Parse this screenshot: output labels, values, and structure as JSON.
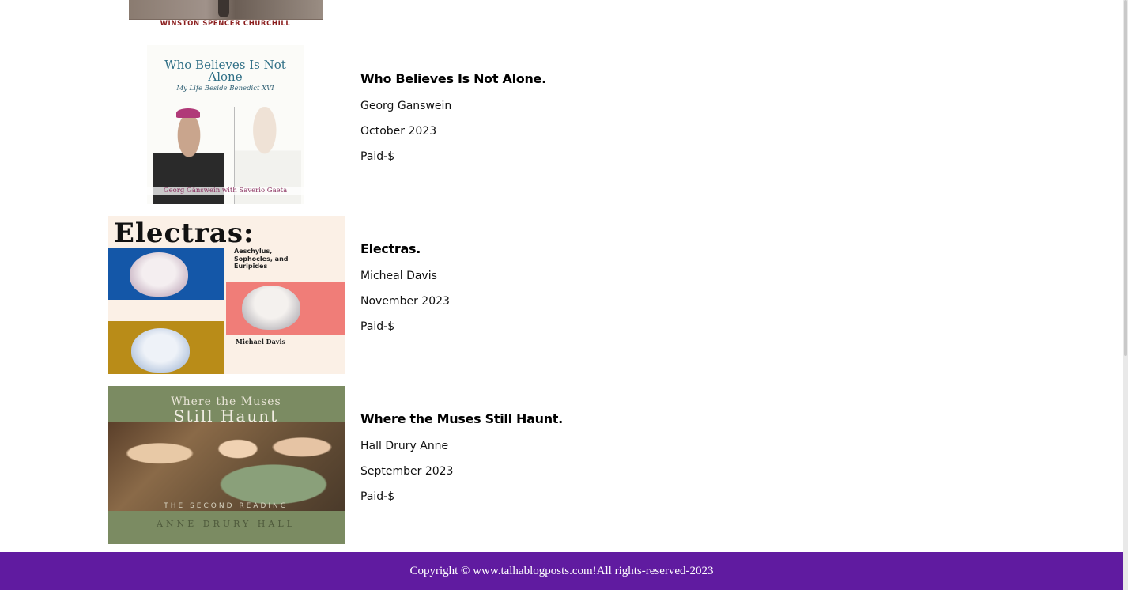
{
  "top_partial": {
    "author_text": "WINSTON SPENCER CHURCHILL"
  },
  "books": [
    {
      "title": "Who Believes Is Not Alone.",
      "author": "Georg Ganswein",
      "date": "October 2023",
      "price": "Paid-$",
      "cover_text": {
        "title": "Who Believes Is Not Alone",
        "subtitle": "My Life Beside Benedict XVI",
        "author": "Georg Gänswein with Saverio Gaeta"
      }
    },
    {
      "title": "Electras.",
      "author": "Micheal Davis",
      "date": "November 2023",
      "price": "Paid-$",
      "cover_text": {
        "title": "Electras:",
        "subtitle": "Aeschylus, Sophocles, and Euripides",
        "author": "Michael Davis"
      }
    },
    {
      "title": "Where the Muses Still Haunt.",
      "author": "Hall Drury Anne",
      "date": "September 2023",
      "price": "Paid-$",
      "cover_text": {
        "title_line1": "Where the Muses",
        "title_line2": "Still Haunt",
        "subtitle": "THE SECOND READING",
        "author": "ANNE DRURY HALL"
      }
    }
  ],
  "footer": {
    "text": "Copyright © www.talhablogposts.com!All rights-reserved-2023"
  },
  "colors": {
    "footer_bg": "#601ba0",
    "footer_text": "#ffffff"
  }
}
